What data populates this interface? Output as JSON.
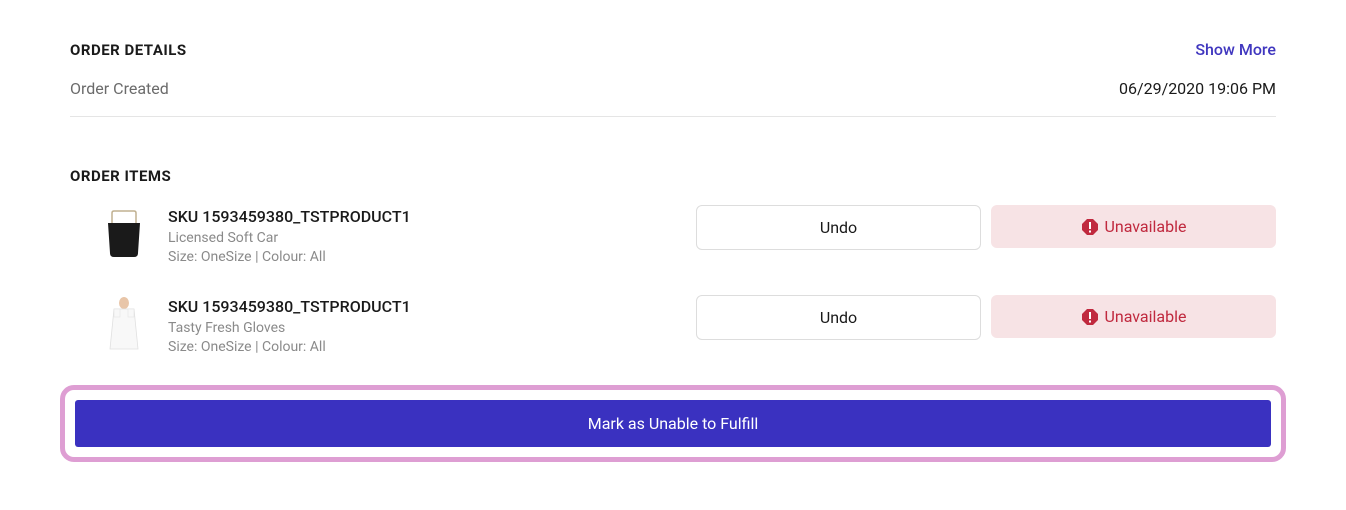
{
  "details": {
    "section_title": "ORDER DETAILS",
    "show_more": "Show More",
    "created_label": "Order Created",
    "created_value": "06/29/2020 19:06 PM"
  },
  "items_section": {
    "title": "ORDER ITEMS"
  },
  "items": [
    {
      "sku": "SKU 1593459380_TSTPRODUCT1",
      "name": "Licensed Soft Car",
      "attrs": "Size: OneSize | Colour: All",
      "undo_label": "Undo",
      "status_label": "Unavailable",
      "thumb_type": "bag"
    },
    {
      "sku": "SKU 1593459380_TSTPRODUCT1",
      "name": "Tasty Fresh Gloves",
      "attrs": "Size: OneSize | Colour: All",
      "undo_label": "Undo",
      "status_label": "Unavailable",
      "thumb_type": "dress"
    }
  ],
  "primary_action": "Mark as Unable to Fulfill"
}
